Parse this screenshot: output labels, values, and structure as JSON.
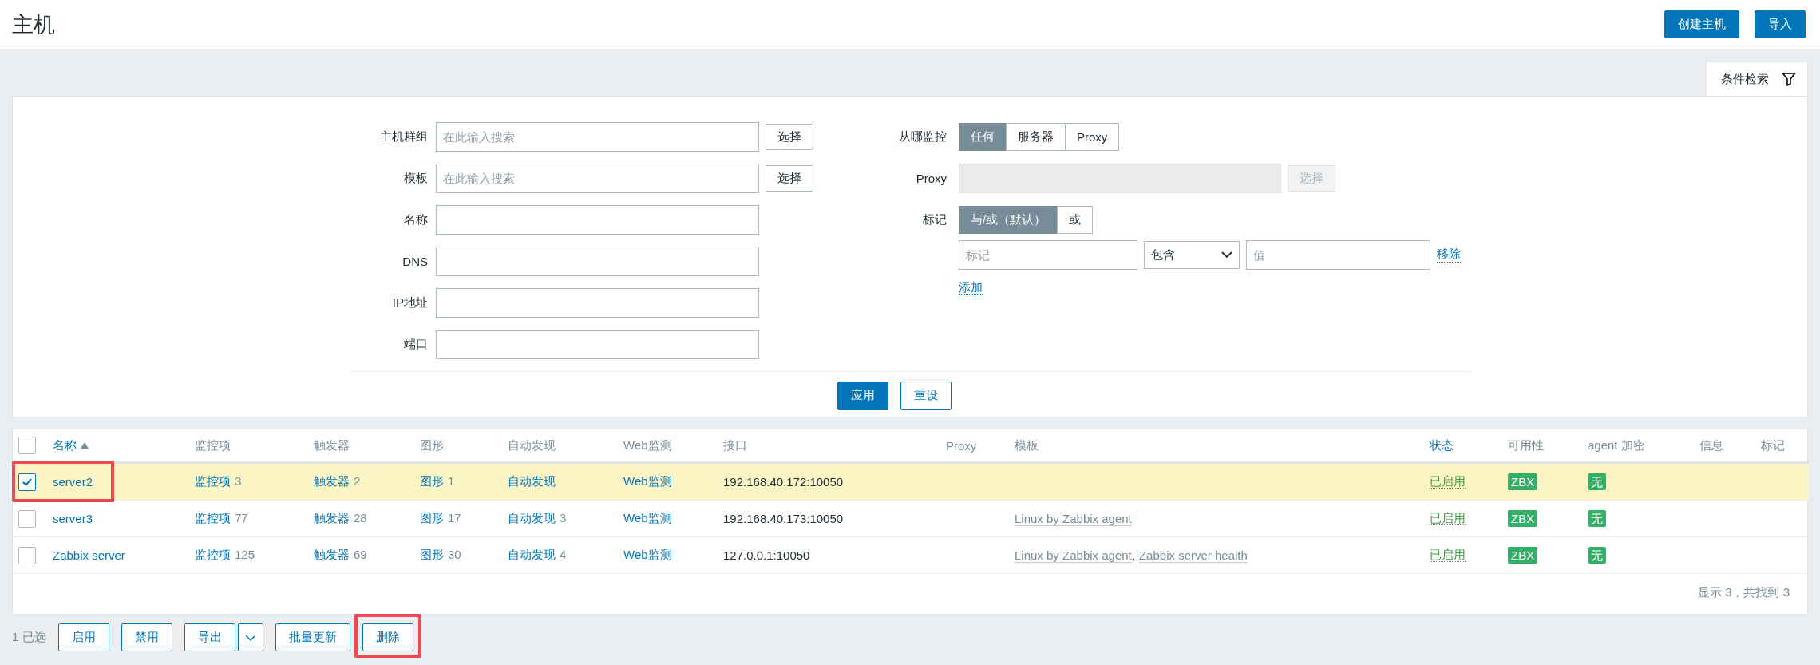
{
  "page": {
    "title": "主机",
    "buttons": [
      "创建主机",
      "导入"
    ]
  },
  "filter_tab": {
    "label": "条件检索",
    "selected": true
  },
  "filter": {
    "left": [
      {
        "label": "主机群组",
        "kind": "multiselect",
        "placeholder": "在此输入搜索",
        "button": "选择"
      },
      {
        "label": "模板",
        "kind": "multiselect",
        "placeholder": "在此输入搜索",
        "button": "选择"
      },
      {
        "label": "名称",
        "kind": "text"
      },
      {
        "label": "DNS",
        "kind": "text"
      },
      {
        "label": "IP地址",
        "kind": "text"
      },
      {
        "label": "端口",
        "kind": "text"
      }
    ],
    "monitored_by": {
      "label": "从哪监控",
      "options": [
        {
          "label": "任何",
          "selected": true
        },
        {
          "label": "服务器",
          "selected": false
        },
        {
          "label": "Proxy",
          "selected": false
        }
      ]
    },
    "proxy": {
      "label": "Proxy",
      "disabled": true,
      "button": "选择"
    },
    "tags": {
      "label": "标记",
      "options": [
        {
          "label": "与/或（默认）",
          "selected": true
        },
        {
          "label": "或",
          "selected": false
        }
      ],
      "row": {
        "tag_placeholder": "标记",
        "operator": "包含",
        "value_placeholder": "值",
        "remove": "移除"
      },
      "add": "添加"
    },
    "apply": "应用",
    "reset": "重设"
  },
  "table": {
    "header_checkbox": {
      "checked": false
    },
    "columns": [
      {
        "label": "名称",
        "sortable": true,
        "sorted": true
      },
      {
        "label": "监控项",
        "sortable": false,
        "sorted": false
      },
      {
        "label": "触发器",
        "sortable": false,
        "sorted": false
      },
      {
        "label": "图形",
        "sortable": false,
        "sorted": false
      },
      {
        "label": "自动发现",
        "sortable": false,
        "sorted": false
      },
      {
        "label": "Web监测",
        "sortable": false,
        "sorted": false
      },
      {
        "label": "接口",
        "sortable": false,
        "sorted": false
      },
      {
        "label": "Proxy",
        "sortable": false,
        "sorted": false
      },
      {
        "label": "模板",
        "sortable": false,
        "sorted": false
      },
      {
        "label": "状态",
        "sortable": true,
        "sorted": false
      },
      {
        "label": "可用性",
        "sortable": false,
        "sorted": false
      },
      {
        "label": "agent 加密",
        "sortable": false,
        "sorted": false
      },
      {
        "label": "信息",
        "sortable": false,
        "sorted": false
      },
      {
        "label": "标记",
        "sortable": false,
        "sorted": false
      }
    ],
    "rows": [
      {
        "selected": true,
        "highlighted": true,
        "name": "server2",
        "links": [
          {
            "label": "监控项",
            "count": "3"
          },
          {
            "label": "触发器",
            "count": "2"
          },
          {
            "label": "图形",
            "count": "1"
          },
          {
            "label": "自动发现"
          },
          {
            "label": "Web监测"
          }
        ],
        "interface": "192.168.40.172:10050",
        "templates": [],
        "status": {
          "text": "已启用",
          "enabled": true
        },
        "availability": {
          "text": "ZBX",
          "available": true
        },
        "encryption": {
          "text": "无",
          "available": true
        }
      },
      {
        "selected": false,
        "highlighted": false,
        "name": "server3",
        "links": [
          {
            "label": "监控项",
            "count": "77"
          },
          {
            "label": "触发器",
            "count": "28"
          },
          {
            "label": "图形",
            "count": "17"
          },
          {
            "label": "自动发现",
            "count": "3"
          },
          {
            "label": "Web监测"
          }
        ],
        "interface": "192.168.40.173:10050",
        "templates": [
          {
            "name": "Linux by Zabbix agent"
          }
        ],
        "status": {
          "text": "已启用",
          "enabled": true
        },
        "availability": {
          "text": "ZBX",
          "available": true
        },
        "encryption": {
          "text": "无",
          "available": true
        }
      },
      {
        "selected": false,
        "highlighted": false,
        "name": "Zabbix server",
        "links": [
          {
            "label": "监控项",
            "count": "125"
          },
          {
            "label": "触发器",
            "count": "69"
          },
          {
            "label": "图形",
            "count": "30"
          },
          {
            "label": "自动发现",
            "count": "4"
          },
          {
            "label": "Web监测"
          }
        ],
        "interface": "127.0.0.1:10050",
        "templates": [
          {
            "name": "Linux by Zabbix agent",
            "separator": ","
          },
          {
            "name": "Zabbix server health"
          }
        ],
        "status": {
          "text": "已启用",
          "enabled": true
        },
        "availability": {
          "text": "ZBX",
          "available": true
        },
        "encryption": {
          "text": "无",
          "available": true
        }
      }
    ],
    "footer": "显示 3，共找到 3"
  },
  "bulk": {
    "selected_count": "1 已选",
    "actions": [
      {
        "label": "启用",
        "kind": "button",
        "highlighted": false
      },
      {
        "label": "禁用",
        "kind": "button",
        "highlighted": false
      },
      {
        "label": "导出",
        "kind": "split",
        "highlighted": false
      },
      {
        "label": "批量更新",
        "kind": "button",
        "highlighted": false
      },
      {
        "label": "删除",
        "kind": "button",
        "highlighted": true
      }
    ]
  }
}
